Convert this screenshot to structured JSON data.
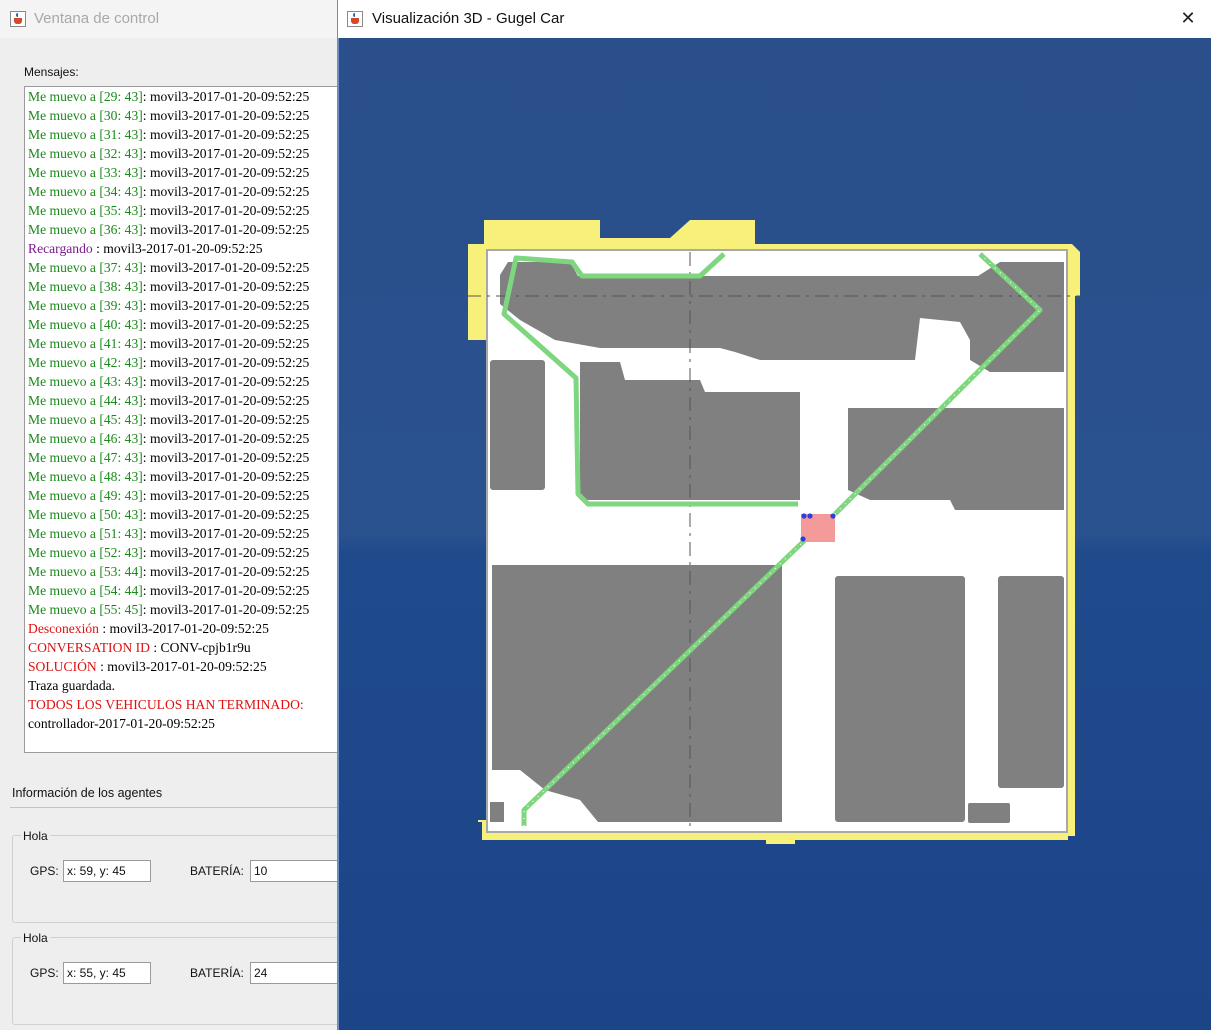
{
  "control_window": {
    "title": "Ventana de control",
    "messages_label": "Mensajes:",
    "messages": [
      {
        "prefix": "Me muevo a [29: 43]",
        "tone": "green",
        "rest": ": movil3-2017-01-20-09:52:25"
      },
      {
        "prefix": "Me muevo a [30: 43]",
        "tone": "green",
        "rest": ": movil3-2017-01-20-09:52:25"
      },
      {
        "prefix": "Me muevo a [31: 43]",
        "tone": "green",
        "rest": ": movil3-2017-01-20-09:52:25"
      },
      {
        "prefix": "Me muevo a [32: 43]",
        "tone": "green",
        "rest": ": movil3-2017-01-20-09:52:25"
      },
      {
        "prefix": "Me muevo a [33: 43]",
        "tone": "green",
        "rest": ": movil3-2017-01-20-09:52:25"
      },
      {
        "prefix": "Me muevo a [34: 43]",
        "tone": "green",
        "rest": ": movil3-2017-01-20-09:52:25"
      },
      {
        "prefix": "Me muevo a [35: 43]",
        "tone": "green",
        "rest": ": movil3-2017-01-20-09:52:25"
      },
      {
        "prefix": "Me muevo a [36: 43]",
        "tone": "green",
        "rest": ": movil3-2017-01-20-09:52:25"
      },
      {
        "prefix": "Recargando ",
        "tone": "purple",
        "rest": ": movil3-2017-01-20-09:52:25"
      },
      {
        "prefix": "Me muevo a [37: 43]",
        "tone": "green",
        "rest": ": movil3-2017-01-20-09:52:25"
      },
      {
        "prefix": "Me muevo a [38: 43]",
        "tone": "green",
        "rest": ": movil3-2017-01-20-09:52:25"
      },
      {
        "prefix": "Me muevo a [39: 43]",
        "tone": "green",
        "rest": ": movil3-2017-01-20-09:52:25"
      },
      {
        "prefix": "Me muevo a [40: 43]",
        "tone": "green",
        "rest": ": movil3-2017-01-20-09:52:25"
      },
      {
        "prefix": "Me muevo a [41: 43]",
        "tone": "green",
        "rest": ": movil3-2017-01-20-09:52:25"
      },
      {
        "prefix": "Me muevo a [42: 43]",
        "tone": "green",
        "rest": ": movil3-2017-01-20-09:52:25"
      },
      {
        "prefix": "Me muevo a [43: 43]",
        "tone": "green",
        "rest": ": movil3-2017-01-20-09:52:25"
      },
      {
        "prefix": "Me muevo a [44: 43]",
        "tone": "green",
        "rest": ": movil3-2017-01-20-09:52:25"
      },
      {
        "prefix": "Me muevo a [45: 43]",
        "tone": "green",
        "rest": ": movil3-2017-01-20-09:52:25"
      },
      {
        "prefix": "Me muevo a [46: 43]",
        "tone": "green",
        "rest": ": movil3-2017-01-20-09:52:25"
      },
      {
        "prefix": "Me muevo a [47: 43]",
        "tone": "green",
        "rest": ": movil3-2017-01-20-09:52:25"
      },
      {
        "prefix": "Me muevo a [48: 43]",
        "tone": "green",
        "rest": ": movil3-2017-01-20-09:52:25"
      },
      {
        "prefix": "Me muevo a [49: 43]",
        "tone": "green",
        "rest": ": movil3-2017-01-20-09:52:25"
      },
      {
        "prefix": "Me muevo a [50: 43]",
        "tone": "green",
        "rest": ": movil3-2017-01-20-09:52:25"
      },
      {
        "prefix": "Me muevo a [51: 43]",
        "tone": "green",
        "rest": ": movil3-2017-01-20-09:52:25"
      },
      {
        "prefix": "Me muevo a [52: 43]",
        "tone": "green",
        "rest": ": movil3-2017-01-20-09:52:25"
      },
      {
        "prefix": "Me muevo a [53: 44]",
        "tone": "green",
        "rest": ": movil3-2017-01-20-09:52:25"
      },
      {
        "prefix": "Me muevo a [54: 44]",
        "tone": "green",
        "rest": ": movil3-2017-01-20-09:52:25"
      },
      {
        "prefix": "Me muevo a [55: 45]",
        "tone": "green",
        "rest": ": movil3-2017-01-20-09:52:25"
      },
      {
        "prefix": "Desconexión ",
        "tone": "red",
        "rest": ": movil3-2017-01-20-09:52:25"
      },
      {
        "prefix": "CONVERSATION ID ",
        "tone": "red",
        "rest": ": CONV-cpjb1r9u"
      },
      {
        "prefix": "SOLUCIÓN ",
        "tone": "red",
        "rest": ": movil3-2017-01-20-09:52:25"
      },
      {
        "prefix": "",
        "tone": "black",
        "rest": "Traza guardada."
      },
      {
        "prefix": "TODOS LOS VEHICULOS HAN TERMINADO:",
        "tone": "red",
        "rest": ""
      },
      {
        "prefix": "",
        "tone": "black",
        "rest": "controllador-2017-01-20-09:52:25"
      }
    ],
    "agents_label": "Información de los agentes",
    "agents": [
      {
        "title": "Hola",
        "gps_label": "GPS:",
        "gps_value": "x: 59, y: 45",
        "battery_label": "BATERÍA:",
        "battery_value": "10"
      },
      {
        "title": "Hola",
        "gps_label": "GPS:",
        "gps_value": "x: 55, y: 45",
        "battery_label": "BATERÍA:",
        "battery_value": "24"
      }
    ]
  },
  "view_window": {
    "title": "Visualización 3D - Gugel Car",
    "close_icon": "close-icon",
    "colors": {
      "background": "#1f4a8a",
      "border": "#f7f07a",
      "road": "#ffffff",
      "building": "#808080",
      "path": "#7ed67e",
      "goal": "#f59a9a",
      "marker": "#2b3fe0"
    }
  }
}
